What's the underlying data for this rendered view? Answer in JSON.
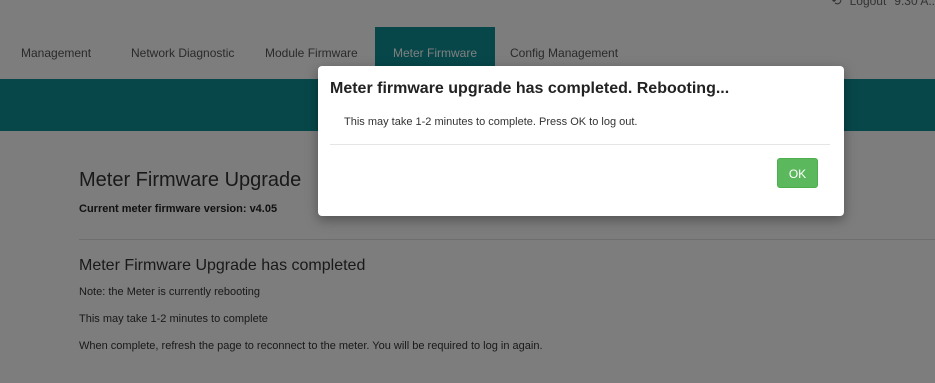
{
  "topbar": {
    "logout_icon": "logout-icon",
    "logout_label": "Logout",
    "time_text": "9:30 A.."
  },
  "nav": {
    "items": [
      {
        "label": "Management"
      },
      {
        "label": "Network Diagnostic"
      },
      {
        "label": "Module Firmware"
      },
      {
        "label": "Meter Firmware",
        "active": true
      },
      {
        "label": "Config Management"
      }
    ],
    "active_color": "#0f8e95"
  },
  "main": {
    "title": "Meter Firmware Upgrade",
    "current_label": "Current meter firmware version:",
    "current_version": "v4.05",
    "status_title": "Meter Firmware Upgrade has completed",
    "notes": [
      "Note: the Meter is currently rebooting",
      "This may take 1-2 minutes to complete",
      "When complete, refresh the page to reconnect to the meter. You will be required to log in again."
    ]
  },
  "modal": {
    "title": "Meter firmware upgrade has completed. Rebooting...",
    "body": "This may take 1-2 minutes to complete. Press OK to log out.",
    "ok_label": "OK",
    "ok_color": "#5cb85c"
  }
}
